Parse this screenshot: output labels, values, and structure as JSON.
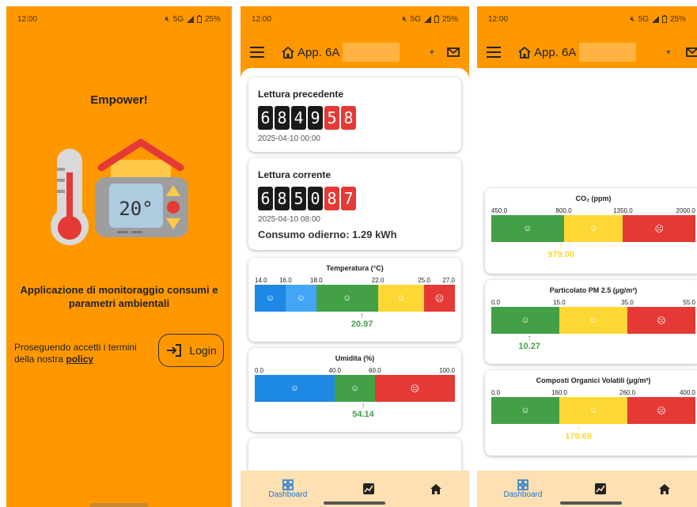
{
  "colors": {
    "orange": "#FF9800",
    "green_val": "#43A047",
    "yellow_val": "#FDD835"
  },
  "status": {
    "time": "12:00",
    "network": "5G",
    "battery": "25%"
  },
  "welcome": {
    "title": "Empower!",
    "thermo_temp": "20°",
    "description": "Applicazione di monitoraggio consumi e parametri ambientali",
    "terms_prefix": "Proseguendo accetti i termini della nostra ",
    "terms_link": "policy",
    "login_label": "Login"
  },
  "appbar": {
    "title": "App. 6A"
  },
  "nav": {
    "dashboard_label": "Dashboard"
  },
  "readings": {
    "previous": {
      "title": "Lettura precedente",
      "digits_black": [
        "6",
        "8",
        "4",
        "9"
      ],
      "digits_red": [
        "5",
        "8"
      ],
      "timestamp": "2025-04-10 00:00"
    },
    "current": {
      "title": "Lettura corrente",
      "digits_black": [
        "6",
        "8",
        "5",
        "0"
      ],
      "digits_red": [
        "8",
        "7"
      ],
      "timestamp": "2025-04-10 08:00",
      "consumption": "Consumo odierno: 1.29 kWh"
    }
  },
  "gauges": {
    "temperatura": {
      "title": "Temperatura (°C)",
      "ticks": [
        "14.0",
        "16.0",
        "18.0",
        "22.0",
        "25.0",
        "27.0"
      ],
      "min": 14,
      "max": 27,
      "segments": [
        {
          "from": 14,
          "to": 16,
          "color": "#1E88E5",
          "icon": "meh"
        },
        {
          "from": 16,
          "to": 18,
          "color": "#42A5F5",
          "icon": "smile"
        },
        {
          "from": 18,
          "to": 22,
          "color": "#43A047",
          "icon": "smile"
        },
        {
          "from": 22,
          "to": 25,
          "color": "#FDD835",
          "icon": "meh"
        },
        {
          "from": 25,
          "to": 27,
          "color": "#E53935",
          "icon": "sad"
        }
      ],
      "value": 20.97,
      "value_label": "20.97",
      "value_color": "#43A047"
    },
    "umidita": {
      "title": "Umidita (%)",
      "ticks": [
        "0.0",
        "40.0",
        "60.0",
        "100.0"
      ],
      "min": 0,
      "max": 100,
      "segments": [
        {
          "from": 0,
          "to": 40,
          "color": "#1E88E5",
          "icon": "meh"
        },
        {
          "from": 40,
          "to": 60,
          "color": "#43A047",
          "icon": "smile"
        },
        {
          "from": 60,
          "to": 100,
          "color": "#E53935",
          "icon": "sad"
        }
      ],
      "value": 54.14,
      "value_label": "54.14",
      "value_color": "#43A047"
    },
    "co2": {
      "title": "CO₂ (ppm)",
      "ticks": [
        "450.0",
        "800.0",
        "1350.0",
        "2000.0"
      ],
      "min": 450,
      "max": 2000,
      "segments": [
        {
          "from": 450,
          "to": 1000,
          "color": "#43A047",
          "icon": "smile"
        },
        {
          "from": 1000,
          "to": 1450,
          "color": "#FDD835",
          "icon": "meh"
        },
        {
          "from": 1450,
          "to": 2000,
          "color": "#E53935",
          "icon": "sad"
        }
      ],
      "value": 979,
      "value_label": "979.00",
      "value_color": "#FDD835"
    },
    "pm25": {
      "title": "Particolato PM 2.5 (μg/m³)",
      "ticks": [
        "0.0",
        "15.0",
        "35.0",
        "55.0"
      ],
      "min": 0,
      "max": 55,
      "segments": [
        {
          "from": 0,
          "to": 18.33,
          "color": "#43A047",
          "icon": "smile"
        },
        {
          "from": 18.33,
          "to": 36.67,
          "color": "#FDD835",
          "icon": "meh"
        },
        {
          "from": 36.67,
          "to": 55,
          "color": "#E53935",
          "icon": "sad"
        }
      ],
      "value": 10.27,
      "value_label": "10.27",
      "value_color": "#43A047"
    },
    "voc": {
      "title": "Composti Organici Volatili (μg/m³)",
      "ticks": [
        "0.0",
        "160.0",
        "260.0",
        "400.0"
      ],
      "min": 0,
      "max": 400,
      "segments": [
        {
          "from": 0,
          "to": 133.3,
          "color": "#43A047",
          "icon": "smile"
        },
        {
          "from": 133.3,
          "to": 266.7,
          "color": "#FDD835",
          "icon": "meh"
        },
        {
          "from": 266.7,
          "to": 400,
          "color": "#E53935",
          "icon": "sad"
        }
      ],
      "value": 170.69,
      "value_label": "170.69",
      "value_color": "#FDD835"
    }
  }
}
